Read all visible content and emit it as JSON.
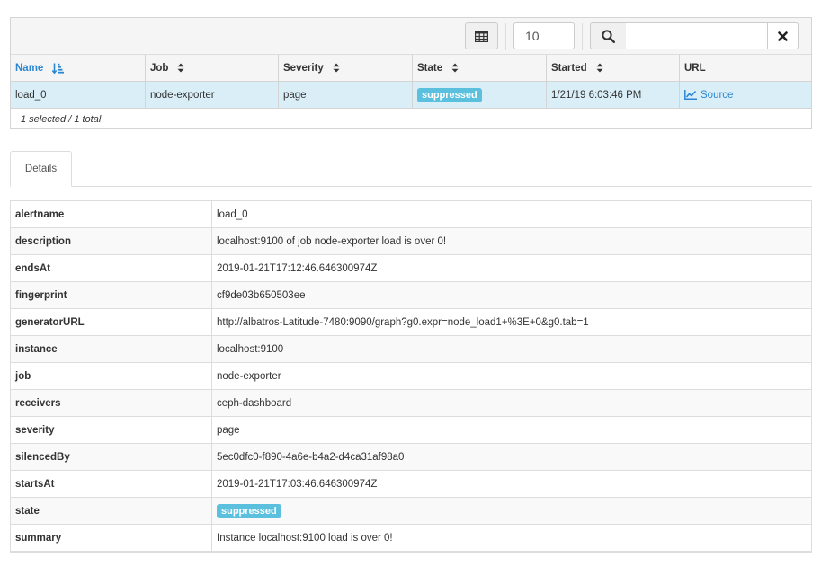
{
  "toolbar": {
    "page_size": "10",
    "search_value": ""
  },
  "table": {
    "columns": [
      {
        "label": "Name",
        "sort": "sorted-asc"
      },
      {
        "label": "Job",
        "sort": "sortable"
      },
      {
        "label": "Severity",
        "sort": "sortable"
      },
      {
        "label": "State",
        "sort": "sortable"
      },
      {
        "label": "Started",
        "sort": "sortable"
      },
      {
        "label": "URL",
        "sort": "none"
      }
    ],
    "rows": [
      {
        "name": "load_0",
        "job": "node-exporter",
        "severity": "page",
        "state": "suppressed",
        "started": "1/21/19 6:03:46 PM",
        "url_label": "Source"
      }
    ],
    "footer": "1 selected / 1 total"
  },
  "tabs": [
    {
      "label": "Details",
      "active": true
    }
  ],
  "details": [
    {
      "key": "alertname",
      "value": "load_0"
    },
    {
      "key": "description",
      "value": "localhost:9100 of job node-exporter load is over 0!"
    },
    {
      "key": "endsAt",
      "value": "2019-01-21T17:12:46.646300974Z"
    },
    {
      "key": "fingerprint",
      "value": "cf9de03b650503ee"
    },
    {
      "key": "generatorURL",
      "value": "http://albatros-Latitude-7480:9090/graph?g0.expr=node_load1+%3E+0&g0.tab=1"
    },
    {
      "key": "instance",
      "value": "localhost:9100"
    },
    {
      "key": "job",
      "value": "node-exporter"
    },
    {
      "key": "receivers",
      "value": "ceph-dashboard"
    },
    {
      "key": "severity",
      "value": "page"
    },
    {
      "key": "silencedBy",
      "value": "5ec0dfc0-f890-4a6e-b4a2-d4ca31af98a0"
    },
    {
      "key": "startsAt",
      "value": "2019-01-21T17:03:46.646300974Z"
    },
    {
      "key": "state",
      "value": "suppressed",
      "badge": true
    },
    {
      "key": "summary",
      "value": "Instance localhost:9100 load is over 0!"
    }
  ],
  "colors": {
    "accent": "#2b87d3",
    "badge": "#5bc0de",
    "selected_row": "#d9eef7"
  }
}
